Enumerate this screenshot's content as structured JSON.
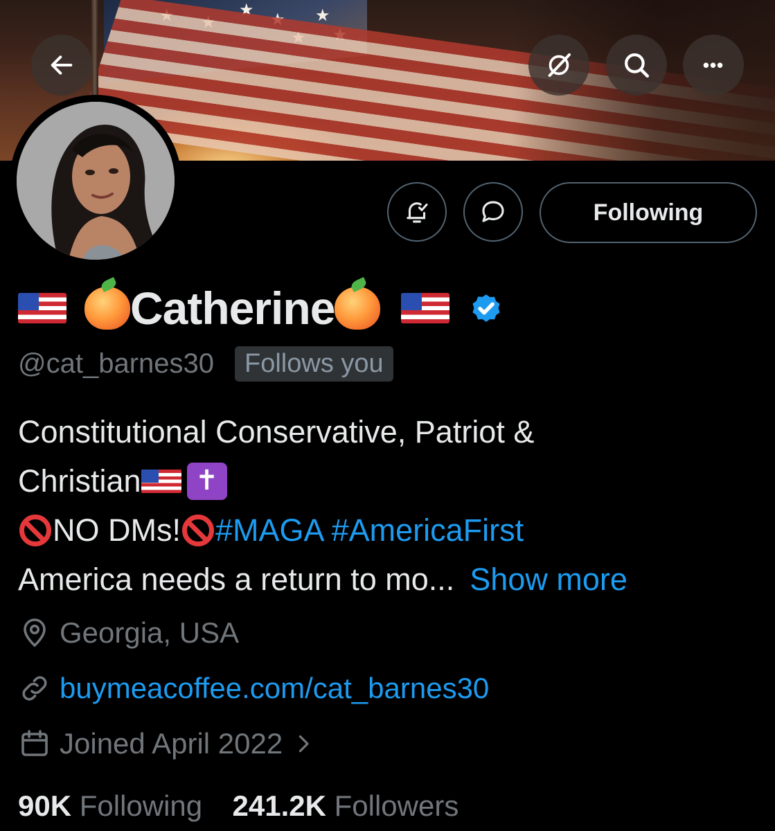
{
  "header": {
    "back_icon": "arrow-left-icon",
    "actions": [
      "grok-icon",
      "search-icon",
      "more-icon"
    ],
    "more_label": "•••"
  },
  "profile": {
    "display_name": "Catherine",
    "verified": true,
    "handle": "@cat_barnes30",
    "follows_you": "Follows you",
    "following_button": "Following",
    "bio_line1": "Constitutional Conservative, Patriot &",
    "bio_line2": "Christian",
    "bio_line2_cross": "✝",
    "bio_line3_text": "NO DMs!",
    "bio_hashtags": "#MAGA #AmericaFirst",
    "bio_line4": "America needs a return to mo...",
    "show_more": "Show more",
    "location": "Georgia, USA",
    "website": "buymeacoffee.com/cat_barnes30",
    "joined": "Joined April 2022",
    "following_count": "90K",
    "following_label": "Following",
    "followers_count": "241.2K",
    "followers_label": "Followers"
  },
  "colors": {
    "accent": "#1d9bf0",
    "muted": "#71767b",
    "text": "#e7e9ea",
    "border": "#536471",
    "background": "#000000"
  }
}
